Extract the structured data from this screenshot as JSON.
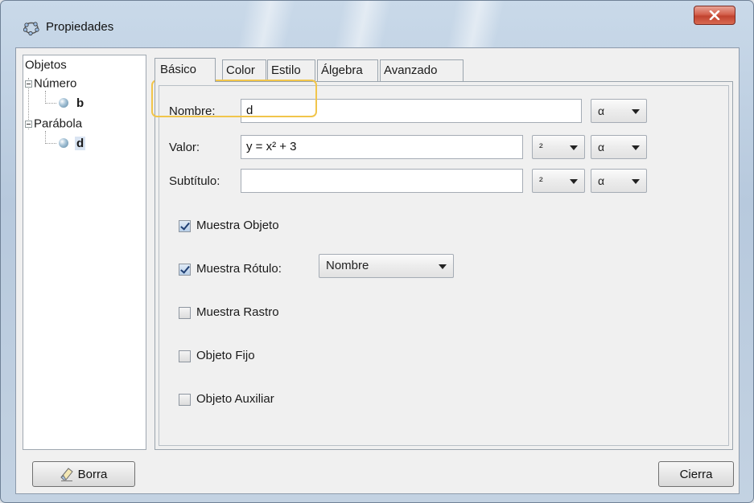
{
  "window": {
    "title": "Propiedades",
    "close_label": "x"
  },
  "tree": {
    "root_label": "Objetos",
    "groups": [
      {
        "label": "Número",
        "children": [
          {
            "label": "b",
            "selected": false
          }
        ]
      },
      {
        "label": "Parábola",
        "children": [
          {
            "label": "d",
            "selected": true
          }
        ]
      }
    ]
  },
  "tabs": [
    {
      "label": "Básico",
      "active": true
    },
    {
      "label": "Color",
      "active": false
    },
    {
      "label": "Estilo",
      "active": false
    },
    {
      "label": "Álgebra",
      "active": false
    },
    {
      "label": "Avanzado",
      "active": false
    }
  ],
  "form": {
    "name_label": "Nombre:",
    "name_value": "d",
    "value_label": "Valor:",
    "value_value": "y = x² + 3",
    "caption_label": "Subtítulo:",
    "caption_value": "",
    "symbol_alpha": "α",
    "symbol_super": "²"
  },
  "checkboxes": {
    "show_object": {
      "label": "Muestra Objeto",
      "checked": true
    },
    "show_label": {
      "label": "Muestra Rótulo:",
      "checked": true
    },
    "label_mode": "Nombre",
    "show_trace": {
      "label": "Muestra Rastro",
      "checked": false
    },
    "fix_object": {
      "label": "Objeto Fijo",
      "checked": false
    },
    "aux_object": {
      "label": "Objeto Auxiliar",
      "checked": false
    }
  },
  "buttons": {
    "delete_label": "Borra",
    "close_label": "Cierra"
  },
  "colors": {
    "highlight": "#f1c54b",
    "close_button": "#c1432f"
  }
}
